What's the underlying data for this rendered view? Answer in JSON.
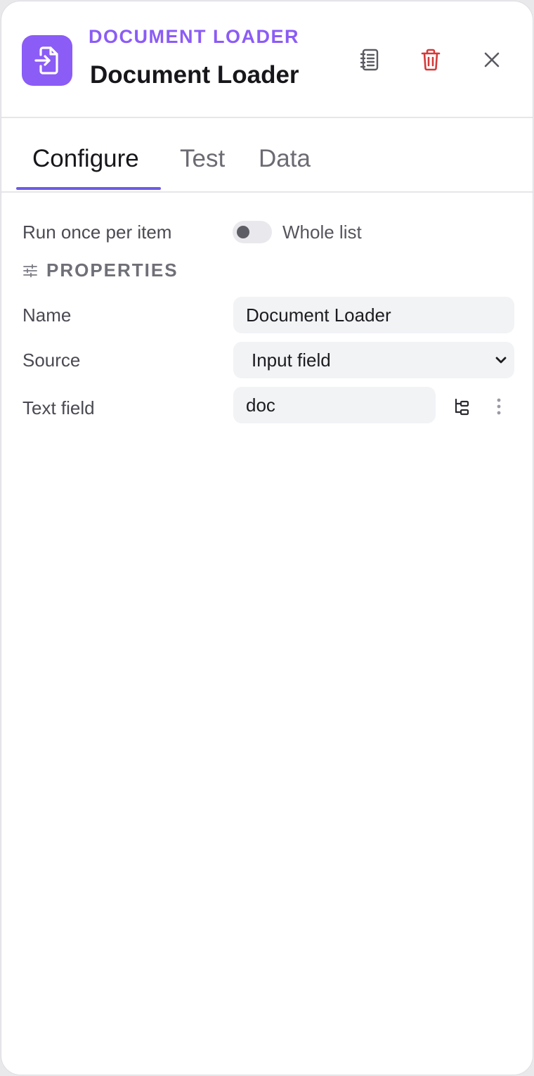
{
  "header": {
    "node_type": "DOCUMENT LOADER",
    "title": "Document Loader",
    "icon": "file-import-icon",
    "accent_color": "#8b5cf6",
    "actions": [
      {
        "icon": "notebook-icon"
      },
      {
        "icon": "trash-icon",
        "color": "#d33a3a"
      },
      {
        "icon": "close-icon"
      }
    ]
  },
  "tabs": [
    {
      "label": "Configure",
      "active": true
    },
    {
      "label": "Test",
      "active": false
    },
    {
      "label": "Data",
      "active": false
    }
  ],
  "run_mode": {
    "label": "Run once per item",
    "toggle_label": "Whole list",
    "enabled": false
  },
  "properties": {
    "section_title": "PROPERTIES",
    "section_icon": "sliders-icon",
    "fields": {
      "name": {
        "label": "Name",
        "value": "Document Loader"
      },
      "source": {
        "label": "Source",
        "value": "Input field"
      },
      "text_field": {
        "label": "Text field",
        "value": "doc",
        "actions": [
          "tree-structure-icon",
          "more-vertical-icon"
        ]
      }
    }
  }
}
